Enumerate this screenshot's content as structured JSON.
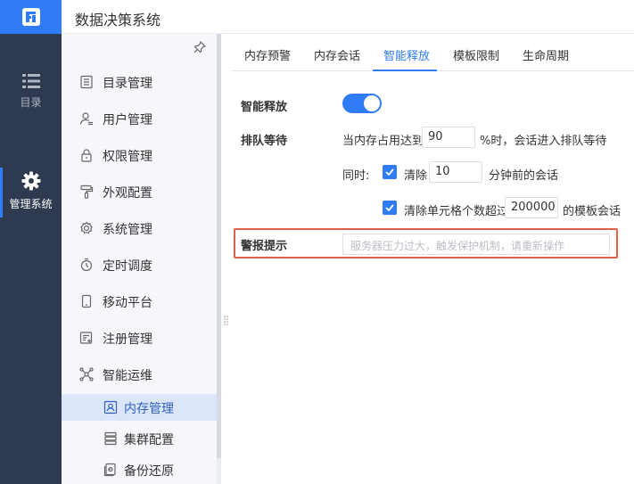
{
  "header": {
    "title": "数据决策系统",
    "logo_icon": "fr-logo-icon"
  },
  "rail": {
    "items": [
      {
        "label": "目录",
        "icon": "list-icon"
      },
      {
        "label": "管理系统",
        "icon": "gear-icon"
      }
    ]
  },
  "sidebar": {
    "items": [
      {
        "label": "目录管理",
        "icon": "catalog-icon"
      },
      {
        "label": "用户管理",
        "icon": "user-icon"
      },
      {
        "label": "权限管理",
        "icon": "lock-icon"
      },
      {
        "label": "外观配置",
        "icon": "paint-roller-icon"
      },
      {
        "label": "系统管理",
        "icon": "settings-icon"
      },
      {
        "label": "定时调度",
        "icon": "timer-icon"
      },
      {
        "label": "移动平台",
        "icon": "mobile-icon"
      },
      {
        "label": "注册管理",
        "icon": "register-icon"
      },
      {
        "label": "智能运维",
        "icon": "ops-icon"
      }
    ],
    "sub_items": [
      {
        "label": "内存管理",
        "icon": "memory-icon",
        "active": true
      },
      {
        "label": "集群配置",
        "icon": "cluster-icon"
      },
      {
        "label": "备份还原",
        "icon": "backup-icon"
      }
    ]
  },
  "tabs": [
    {
      "label": "内存预警"
    },
    {
      "label": "内存会话"
    },
    {
      "label": "智能释放",
      "active": true
    },
    {
      "label": "模板限制"
    },
    {
      "label": "生命周期"
    }
  ],
  "form": {
    "smart_release_label": "智能释放",
    "smart_release_on": true,
    "queue_label": "排队等待",
    "queue_prefix": "当内存占用达到",
    "queue_value": "90",
    "queue_suffix": "%时，会话进入排队等待",
    "meanwhile_label": "同时:",
    "clear_label": "清除",
    "clear_minutes_value": "10",
    "clear_minutes_suffix": "分钟前的会话",
    "clear_cells_label": "清除单元格个数超过",
    "clear_cells_value": "200000",
    "clear_cells_suffix": "的模板会话",
    "alert_label": "警报提示",
    "alert_placeholder": "服务器压力过大，触发保护机制，请重新操作"
  },
  "colors": {
    "accent": "#2f7cf6",
    "rail_bg": "#2e3a50",
    "highlight_border": "#e0604a"
  }
}
